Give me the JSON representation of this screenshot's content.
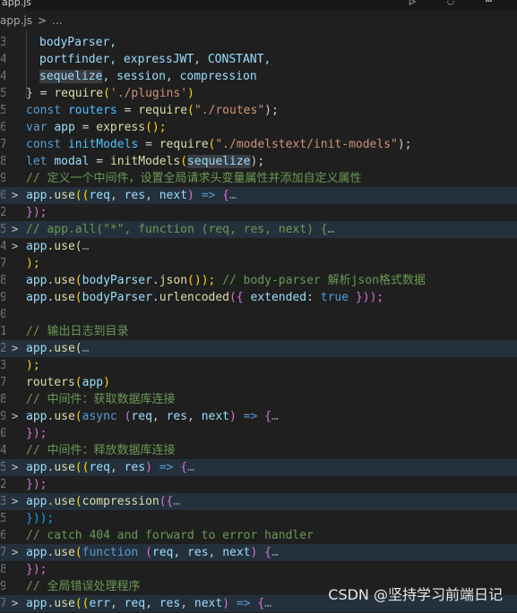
{
  "tab": {
    "title": "app.js",
    "actions": "▷ ◌ ⋯"
  },
  "breadcrumb": {
    "file": "app.js",
    "sep": ">",
    "more": "..."
  },
  "line_numbers": [
    "3",
    "4",
    "4",
    "5",
    "5",
    "6",
    "7",
    "8",
    "9",
    "0",
    "2",
    "5",
    "4",
    "7",
    "8",
    "9",
    "0",
    "1",
    "2",
    "3",
    "7",
    "8",
    "9",
    "0",
    "4",
    "5",
    "2",
    "3",
    "5",
    "6",
    "7",
    "8",
    "9",
    "7"
  ],
  "code": {
    "l1_a": "bodyParser,",
    "l2_a": "portfinder, expressJWT, CONSTANT,",
    "l3_a": "sequelize",
    "l3_b": ", session, compression",
    "l4_a": "} = ",
    "l4_b": "require",
    "l4_c": "(",
    "l4_d": "'./plugins'",
    "l4_e": ")",
    "l5_a": "const ",
    "l5_b": "routers",
    "l5_c": " = ",
    "l5_d": "require",
    "l5_e": "(",
    "l5_f": "\"./routes\"",
    "l5_g": ");",
    "l6_a": "var ",
    "l6_b": "app",
    "l6_c": " = ",
    "l6_d": "express",
    "l6_e": "();",
    "l7_a": "const ",
    "l7_b": "initModels",
    "l7_c": " = ",
    "l7_d": "require",
    "l7_e": "(",
    "l7_f": "\"./modelstext/init-models\"",
    "l7_g": ");",
    "l8_a": "let ",
    "l8_b": "modal",
    "l8_c": " = ",
    "l8_d": "initModels",
    "l8_e": "(",
    "l8_f": "sequelize",
    "l8_g": ");",
    "l9": "// 定义一个中间件，设置全局请求头变量属性并添加自定义属性",
    "l10_a": "app",
    "l10_b": ".",
    "l10_c": "use",
    "l10_d": "((",
    "l10_e": "req",
    "l10_f": ", ",
    "l10_g": "res",
    "l10_h": ", ",
    "l10_i": "next",
    "l10_j": ") ",
    "l10_k": "=>",
    "l10_l": " {",
    "l10_m": "…",
    "l11": "});",
    "l12": "// app.all(\"*\", function (req, res, next) {",
    "l12_m": "…",
    "l13_a": "app",
    "l13_b": ".use(",
    "l13_m": "…",
    "l14": ");",
    "l15_a": "app",
    "l15_b": ".",
    "l15_c": "use",
    "l15_d": "(",
    "l15_e": "bodyParser",
    "l15_f": ".",
    "l15_g": "json",
    "l15_h": "()); ",
    "l15_i": "// body-parser 解析json格式数据",
    "l16_a": "app",
    "l16_b": ".",
    "l16_c": "use",
    "l16_d": "(",
    "l16_e": "bodyParser",
    "l16_f": ".",
    "l16_g": "urlencoded",
    "l16_h": "({ ",
    "l16_i": "extended",
    "l16_j": ": ",
    "l16_k": "true",
    "l16_l": " }));",
    "l18": "// 输出日志到目录",
    "l19_a": "app",
    "l19_b": ".use(",
    "l19_m": "…",
    "l20": ");",
    "l21_a": "routers",
    "l21_b": "(",
    "l21_c": "app",
    "l21_d": ")",
    "l22": "// 中间件：获取数据库连接",
    "l23_a": "app",
    "l23_b": ".",
    "l23_c": "use",
    "l23_d": "(",
    "l23_e": "async",
    "l23_f": " (",
    "l23_g": "req",
    "l23_h": ", ",
    "l23_i": "res",
    "l23_j": ", ",
    "l23_k": "next",
    "l23_l": ") ",
    "l23_n": "=>",
    "l23_o": " {",
    "l23_m": "…",
    "l24": "});",
    "l25": "// 中间件：释放数据库连接",
    "l26_a": "app",
    "l26_b": ".",
    "l26_c": "use",
    "l26_d": "((",
    "l26_e": "req",
    "l26_f": ", ",
    "l26_g": "res",
    "l26_h": ") ",
    "l26_i": "=>",
    "l26_j": " {",
    "l26_m": "…",
    "l27": "});",
    "l28_a": "app",
    "l28_b": ".",
    "l28_c": "use",
    "l28_d": "(",
    "l28_e": "compression",
    "l28_f": "({",
    "l28_m": "…",
    "l29": "}));",
    "l30": "// catch 404 and forward to error handler",
    "l31_a": "app",
    "l31_b": ".",
    "l31_c": "use",
    "l31_d": "(",
    "l31_e": "function",
    "l31_f": " (",
    "l31_g": "req",
    "l31_h": ", ",
    "l31_i": "res",
    "l31_j": ", ",
    "l31_k": "next",
    "l31_l": ") {",
    "l31_m": "…",
    "l32": "});",
    "l33": "// 全局错误处理程序",
    "l34_a": "app",
    "l34_b": ".",
    "l34_c": "use",
    "l34_d": "((",
    "l34_e": "err",
    "l34_f": ", ",
    "l34_g": "req",
    "l34_h": ", ",
    "l34_i": "res",
    "l34_j": ", ",
    "l34_k": "next",
    "l34_l": ") ",
    "l34_n": "=>",
    "l34_o": " {",
    "l34_m": "…"
  },
  "fold_icon": ">",
  "watermark": "CSDN @坚持学习前端日记",
  "colors": {
    "keyword": "#569cd6",
    "comment": "#6a9955",
    "string": "#ce9178",
    "function": "#dcdcaa",
    "variable": "#9cdcfe",
    "highlight": "#24303b"
  }
}
